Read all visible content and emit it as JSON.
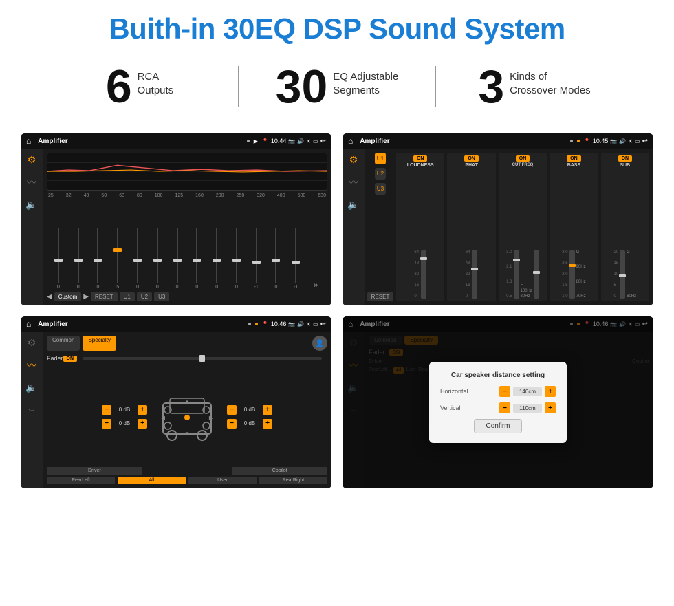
{
  "header": {
    "title": "Buith-in 30EQ DSP Sound System"
  },
  "stats": [
    {
      "number": "6",
      "text": "RCA\nOutputs"
    },
    {
      "number": "30",
      "text": "EQ Adjustable\nSegments"
    },
    {
      "number": "3",
      "text": "Kinds of\nCrossover Modes"
    }
  ],
  "screens": [
    {
      "id": "eq-screen",
      "statusBar": {
        "appName": "Amplifier",
        "time": "10:44",
        "mode": "play"
      },
      "type": "eq"
    },
    {
      "id": "crossover-screen",
      "statusBar": {
        "appName": "Amplifier",
        "time": "10:45",
        "mode": "settings"
      },
      "type": "crossover"
    },
    {
      "id": "fader-screen",
      "statusBar": {
        "appName": "Amplifier",
        "time": "10:46",
        "mode": "settings"
      },
      "type": "fader"
    },
    {
      "id": "dialog-screen",
      "statusBar": {
        "appName": "Amplifier",
        "time": "10:46",
        "mode": "settings"
      },
      "type": "dialog",
      "dialog": {
        "title": "Car speaker distance setting",
        "horizontal_label": "Horizontal",
        "horizontal_value": "140cm",
        "vertical_label": "Vertical",
        "vertical_value": "110cm",
        "confirm_label": "Confirm"
      }
    }
  ],
  "eq": {
    "frequencies": [
      "25",
      "32",
      "40",
      "50",
      "63",
      "80",
      "100",
      "125",
      "160",
      "200",
      "250",
      "320",
      "400",
      "500",
      "630"
    ],
    "values": [
      "0",
      "0",
      "0",
      "5",
      "0",
      "0",
      "0",
      "0",
      "0",
      "0",
      "-1",
      "0",
      "-1"
    ],
    "preset": "Custom",
    "buttons": [
      "RESET",
      "U1",
      "U2",
      "U3"
    ]
  },
  "crossover": {
    "u_buttons": [
      "U1",
      "U2",
      "U3"
    ],
    "channels": [
      "LOUDNESS",
      "PHAT",
      "CUT FREQ",
      "BASS",
      "SUB"
    ],
    "on_label": "ON"
  },
  "fader": {
    "tabs": [
      "Common",
      "Specialty"
    ],
    "active_tab": "Specialty",
    "fader_label": "Fader",
    "on_label": "ON",
    "db_values": [
      "0 dB",
      "0 dB",
      "0 dB",
      "0 dB"
    ],
    "bottom_buttons": [
      "Driver",
      "",
      "Copilot",
      "RearLeft",
      "All",
      "User",
      "RearRight"
    ],
    "active_bottom": "All"
  },
  "dialog": {
    "title": "Car speaker distance setting",
    "horizontal_label": "Horizontal",
    "horizontal_value": "140cm",
    "vertical_label": "Vertical",
    "vertical_value": "110cm",
    "confirm_label": "Confirm"
  }
}
